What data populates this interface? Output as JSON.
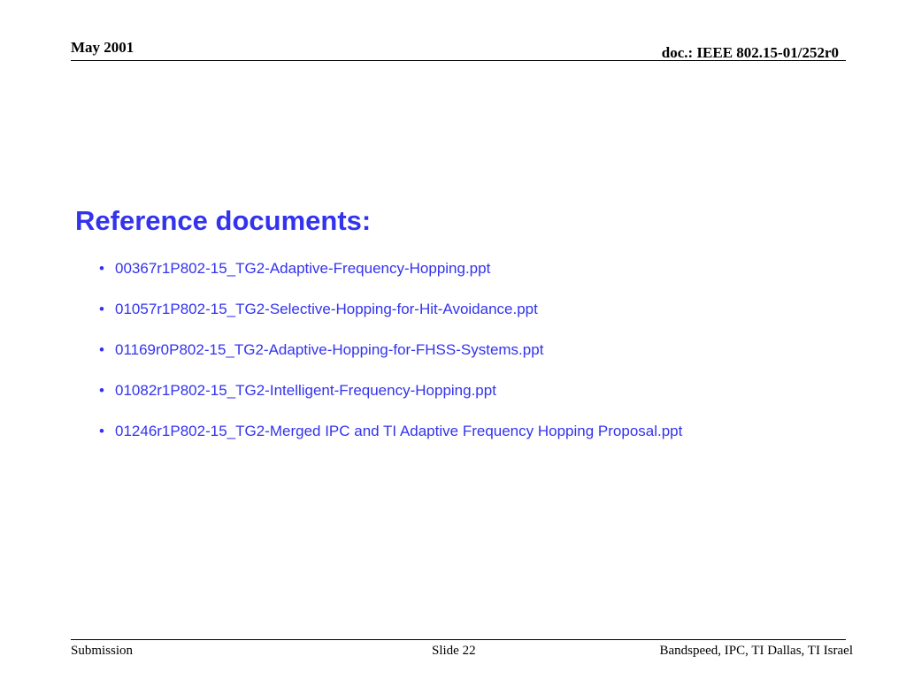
{
  "header": {
    "date": "May 2001",
    "doc_id": "doc.: IEEE 802.15-01/252r0"
  },
  "slide": {
    "title": "Reference documents:",
    "bullet_glyph": "•",
    "references": [
      "00367r1P802-15_TG2-Adaptive-Frequency-Hopping.ppt",
      "01057r1P802-15_TG2-Selective-Hopping-for-Hit-Avoidance.ppt",
      "01169r0P802-15_TG2-Adaptive-Hopping-for-FHSS-Systems.ppt",
      "01082r1P802-15_TG2-Intelligent-Frequency-Hopping.ppt",
      "01246r1P802-15_TG2-Merged IPC and TI Adaptive Frequency Hopping Proposal.ppt"
    ]
  },
  "footer": {
    "left": "Submission",
    "center": "Slide 22",
    "right": "Bandspeed, IPC, TI Dallas, TI Israel"
  },
  "colors": {
    "title": "#3333ee",
    "text": "#000000"
  }
}
